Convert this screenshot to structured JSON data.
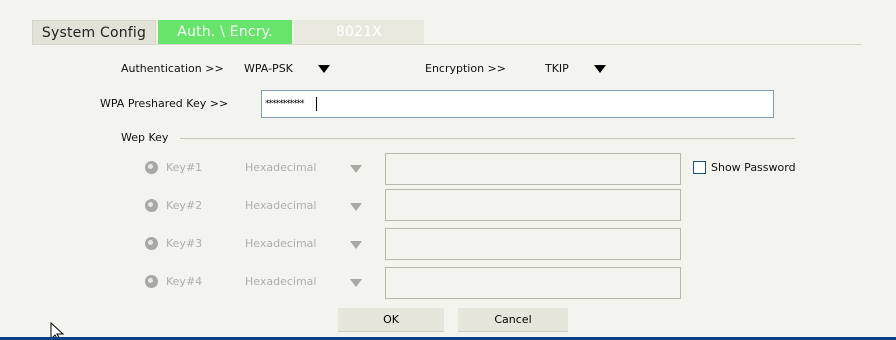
{
  "tabs": [
    {
      "label": "System Config",
      "active": false
    },
    {
      "label": "Auth. \\ Encry.",
      "active": true
    },
    {
      "label": "8021X",
      "active": false
    }
  ],
  "auth": {
    "label": "Authentication >>",
    "value": "WPA-PSK",
    "encryption_label": "Encryption >>",
    "encryption_value": "TKIP"
  },
  "wpa": {
    "label": "WPA Preshared Key >>",
    "value": "***********"
  },
  "wep": {
    "group_label": "Wep Key",
    "keys": [
      {
        "label": "Key#1",
        "format": "Hexadecimal",
        "value": ""
      },
      {
        "label": "Key#2",
        "format": "Hexadecimal",
        "value": ""
      },
      {
        "label": "Key#3",
        "format": "Hexadecimal",
        "value": ""
      },
      {
        "label": "Key#4",
        "format": "Hexadecimal",
        "value": ""
      }
    ],
    "show_password_label": "Show Password"
  },
  "buttons": {
    "ok": "OK",
    "cancel": "Cancel"
  },
  "colors": {
    "active_tab": "#66e56a",
    "bottom_bar": "#0b3e8c"
  }
}
